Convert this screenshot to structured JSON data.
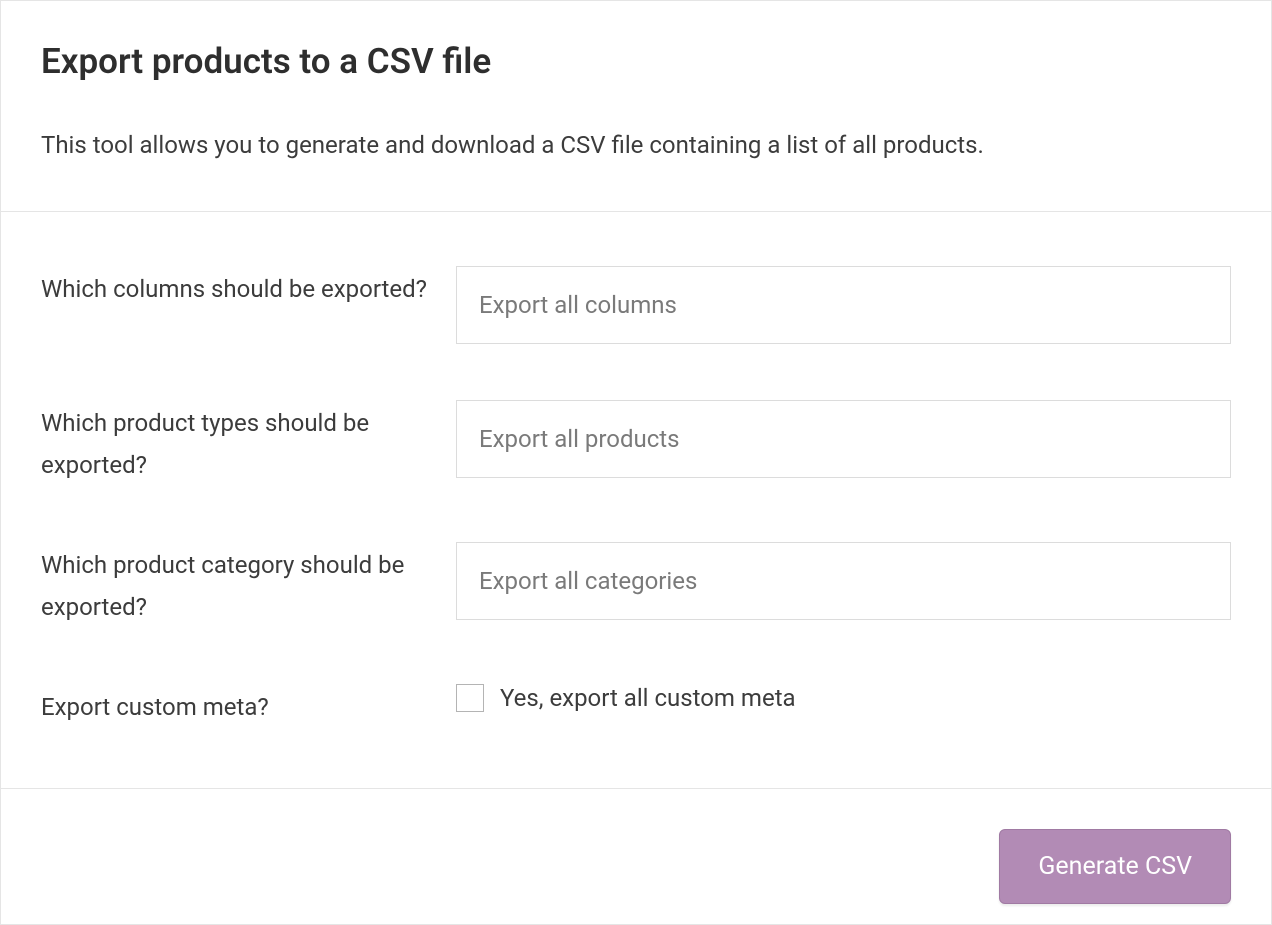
{
  "header": {
    "title": "Export products to a CSV file",
    "description": "This tool allows you to generate and download a CSV file containing a list of all products."
  },
  "form": {
    "columns": {
      "label": "Which columns should be exported?",
      "placeholder": "Export all columns"
    },
    "product_types": {
      "label": "Which product types should be exported?",
      "placeholder": "Export all products"
    },
    "categories": {
      "label": "Which product category should be exported?",
      "placeholder": "Export all categories"
    },
    "custom_meta": {
      "label": "Export custom meta?",
      "checkbox_label": "Yes, export all custom meta",
      "checked": false
    }
  },
  "actions": {
    "generate_label": "Generate CSV"
  },
  "colors": {
    "accent": "#b28bb5",
    "border": "#e5e5e5",
    "text": "#3c3c3c"
  }
}
